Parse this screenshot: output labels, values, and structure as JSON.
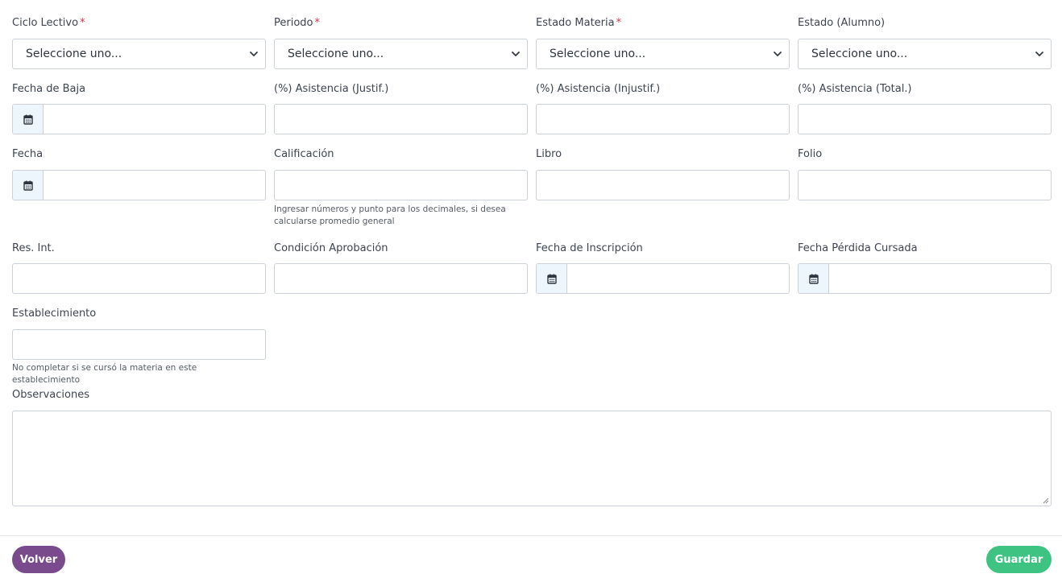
{
  "fields": {
    "ciclo_lectivo": {
      "label": "Ciclo Lectivo",
      "required": "*",
      "value": "Seleccione uno..."
    },
    "periodo": {
      "label": "Periodo",
      "required": "*",
      "value": "Seleccione uno..."
    },
    "estado_materia": {
      "label": "Estado Materia",
      "required": "*",
      "value": "Seleccione uno..."
    },
    "estado_alumno": {
      "label": "Estado (Alumno)",
      "value": "Seleccione uno..."
    },
    "fecha_baja": {
      "label": "Fecha de Baja",
      "value": ""
    },
    "asistencia_justif": {
      "label": "(%) Asistencia (Justif.)",
      "value": ""
    },
    "asistencia_injustif": {
      "label": "(%) Asistencia (Injustif.)",
      "value": ""
    },
    "asistencia_total": {
      "label": "(%) Asistencia (Total.)",
      "value": ""
    },
    "fecha": {
      "label": "Fecha",
      "value": ""
    },
    "calificacion": {
      "label": "Calificación",
      "value": "",
      "help": "Ingresar números y punto para los decimales, si desea calcularse promedio general"
    },
    "libro": {
      "label": "Libro",
      "value": ""
    },
    "folio": {
      "label": "Folio",
      "value": ""
    },
    "res_int": {
      "label": "Res. Int.",
      "value": ""
    },
    "condicion_aprobacion": {
      "label": "Condición Aprobación",
      "value": ""
    },
    "fecha_inscripcion": {
      "label": "Fecha de Inscripción",
      "value": ""
    },
    "fecha_perdida_cursada": {
      "label": "Fecha Pérdida Cursada",
      "value": ""
    },
    "establecimiento": {
      "label": "Establecimiento",
      "value": "",
      "help": "No completar si se cursó la materia en este establecimiento"
    },
    "observaciones": {
      "label": "Observaciones",
      "value": ""
    }
  },
  "buttons": {
    "back_label": "Volver",
    "save_label": "Guardar"
  },
  "icons": {
    "date_addon": "calendar-icon",
    "select_arrow": "chevron-down-icon"
  },
  "colors": {
    "required": "#e0314b",
    "back_button": "#7a4b8c",
    "save_button": "#3ec383",
    "date_addon_bg": "#eef6fd",
    "border": "#ccd1d8"
  }
}
